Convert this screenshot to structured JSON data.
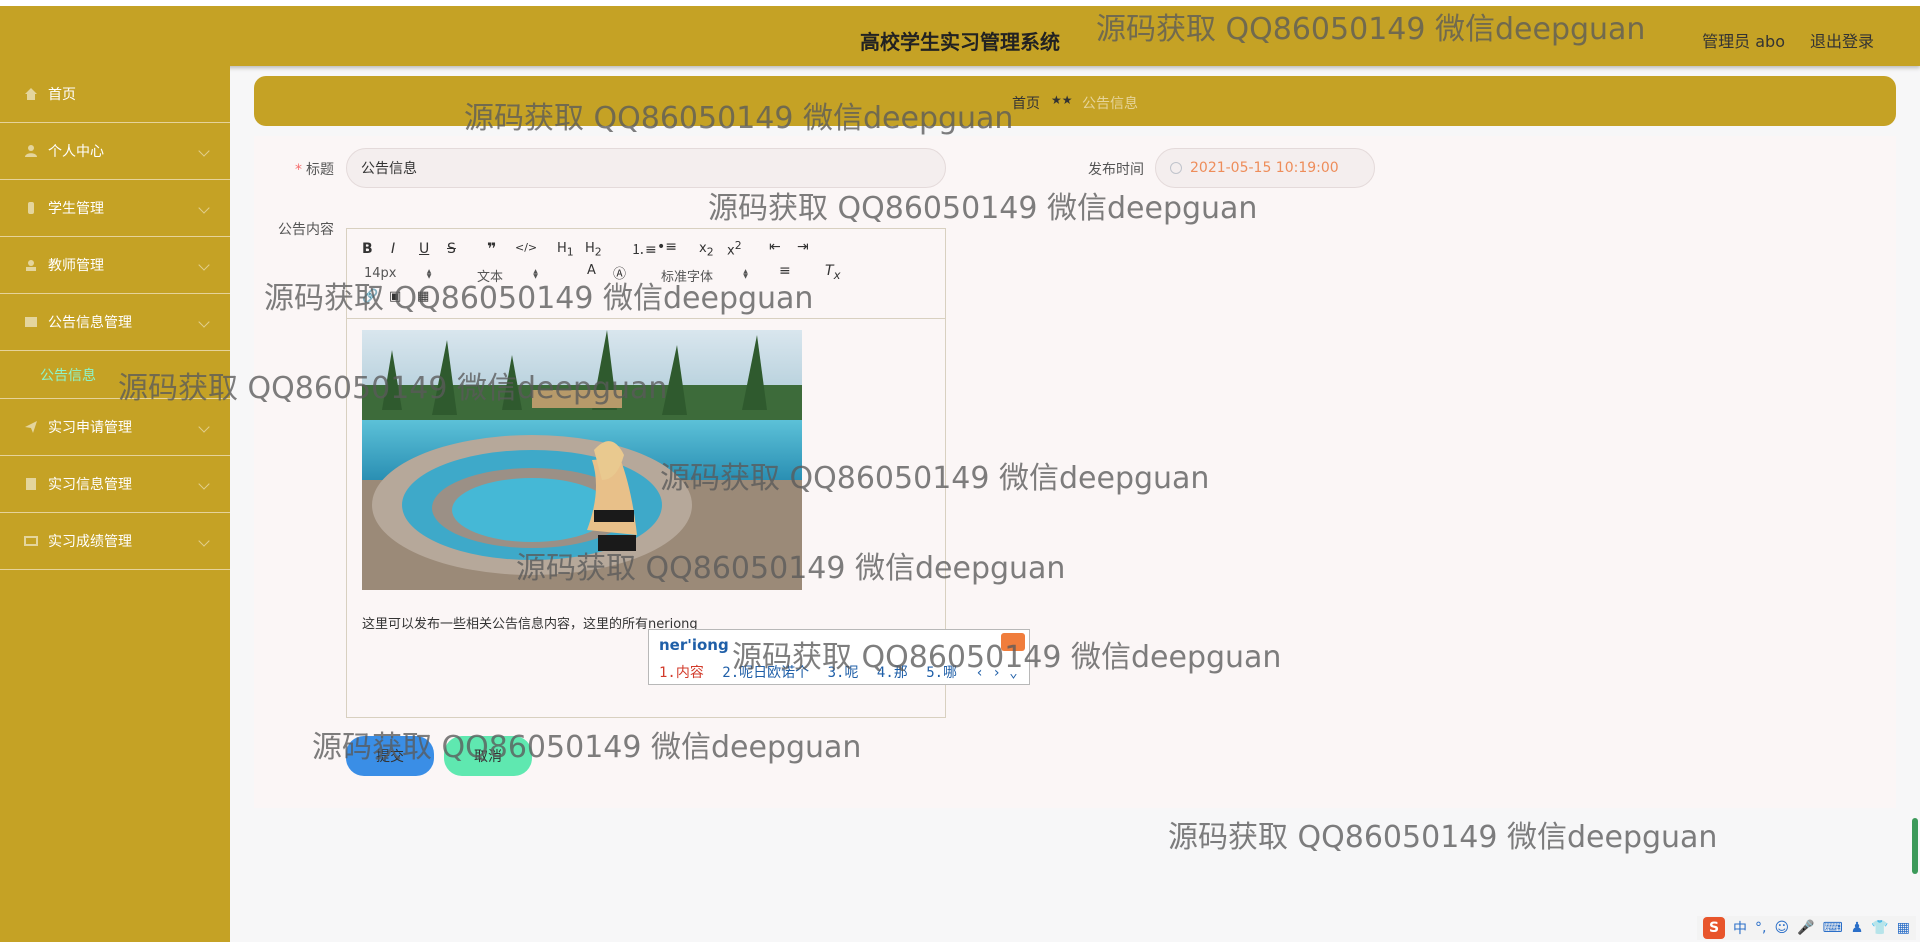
{
  "header": {
    "title": "高校学生实习管理系统",
    "user": "管理员 abo",
    "logout": "退出登录"
  },
  "sidebar": {
    "items": [
      {
        "label": "首页",
        "icon": "home-icon"
      },
      {
        "label": "个人中心",
        "icon": "user-icon"
      },
      {
        "label": "学生管理",
        "icon": "student-icon"
      },
      {
        "label": "教师管理",
        "icon": "teacher-icon"
      },
      {
        "label": "公告信息管理",
        "icon": "notice-icon"
      },
      {
        "label": "实习申请管理",
        "icon": "send-icon"
      },
      {
        "label": "实习信息管理",
        "icon": "doc-icon"
      },
      {
        "label": "实习成绩管理",
        "icon": "grade-icon"
      }
    ],
    "submenu": "公告信息"
  },
  "breadcrumb": {
    "home": "首页",
    "separator": "★★",
    "current": "公告信息"
  },
  "form": {
    "title_label": "标题",
    "title_value": "公告信息",
    "publish_label": "发布时间",
    "publish_value": "2021-05-15 10:19:00",
    "content_label": "公告内容"
  },
  "editor": {
    "font_size": "14px",
    "text_style": "文本",
    "font_family": "标准字体",
    "body": "这里可以发布一些相关公告信息内容，这里的所有",
    "typing": "neriong"
  },
  "ime": {
    "pinyin": "ner'iong",
    "candidates": [
      "1.内容",
      "2.呢日欧诺个",
      "3.呢",
      "4.那",
      "5.哪"
    ]
  },
  "buttons": {
    "submit": "提交",
    "cancel": "取消"
  },
  "watermark": "源码获取 QQ86050149 微信deepguan",
  "tray": {
    "lang": "中"
  }
}
